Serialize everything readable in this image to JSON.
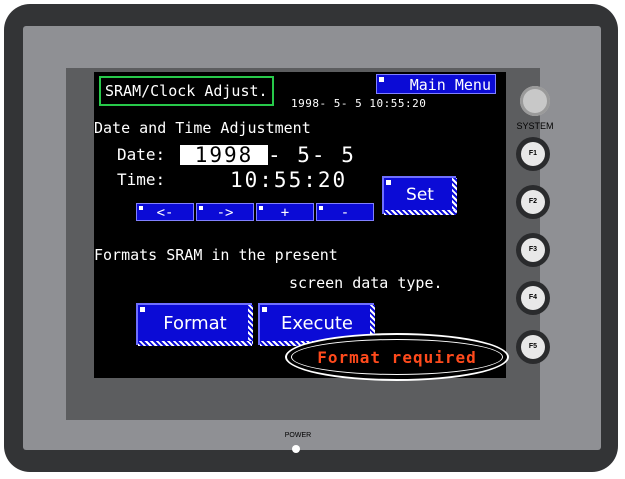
{
  "screen": {
    "title": "SRAM/Clock Adjust.",
    "main_menu_label": "Main Menu",
    "current_datetime": "1998- 5- 5 10:55:20",
    "heading": "Date and Time Adjustment",
    "date_label": "Date:",
    "date_year": "1998",
    "date_rest": "- 5- 5",
    "time_label": "Time:",
    "time_value": "10:55:20",
    "arrow_buttons": [
      "<-",
      "->",
      "+",
      "-"
    ],
    "set_label": "Set",
    "format_desc_line1": "Formats SRAM in the present",
    "format_desc_line2": "screen data type.",
    "format_label": "Format",
    "execute_label": "Execute",
    "status_text": "Format required"
  },
  "hardware": {
    "system_label": "SYSTEM",
    "function_keys": [
      "F1",
      "F2",
      "F3",
      "F4",
      "F5"
    ],
    "power_label": "POWER"
  },
  "colors": {
    "button_blue": "#0b0bd6",
    "title_border_green": "#27c94a",
    "status_red": "#ff4a1c"
  }
}
